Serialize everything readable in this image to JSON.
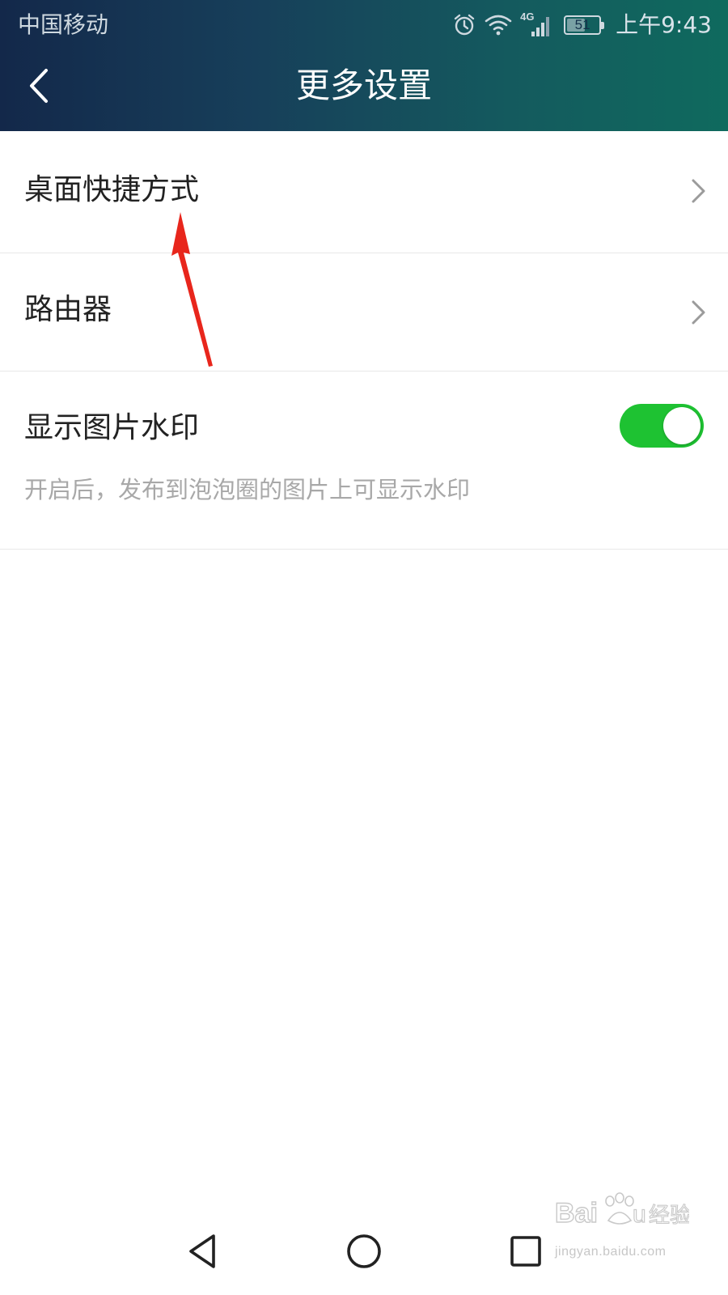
{
  "status_bar": {
    "carrier": "中国移动",
    "network_label": "4G",
    "battery_level": "51",
    "time": "上午9:43",
    "icons": [
      "alarm-icon",
      "wifi-icon",
      "cellular-signal-icon",
      "battery-icon"
    ]
  },
  "title_bar": {
    "title": "更多设置",
    "back_icon": "chevron-left-icon"
  },
  "settings": {
    "items": [
      {
        "label": "桌面快捷方式",
        "trailing": "chevron-right-icon"
      },
      {
        "label": "路由器",
        "trailing": "chevron-right-icon"
      },
      {
        "label": "显示图片水印",
        "description": "开启后，发布到泡泡圈的图片上可显示水印",
        "toggle_on": true
      }
    ]
  },
  "annotation": {
    "type": "arrow",
    "color": "#e8261c"
  },
  "nav_bar": {
    "buttons": [
      "back-triangle-icon",
      "home-circle-icon",
      "recents-square-icon"
    ]
  },
  "watermark": {
    "brand": "Baidu经验",
    "url": "jingyan.baidu.com"
  },
  "colors": {
    "header_gradient_start": "#13284a",
    "header_gradient_end": "#0f6a5e",
    "toggle_on": "#1ec232",
    "divider": "#e8e8e8",
    "description_text": "#a8a8a8"
  }
}
